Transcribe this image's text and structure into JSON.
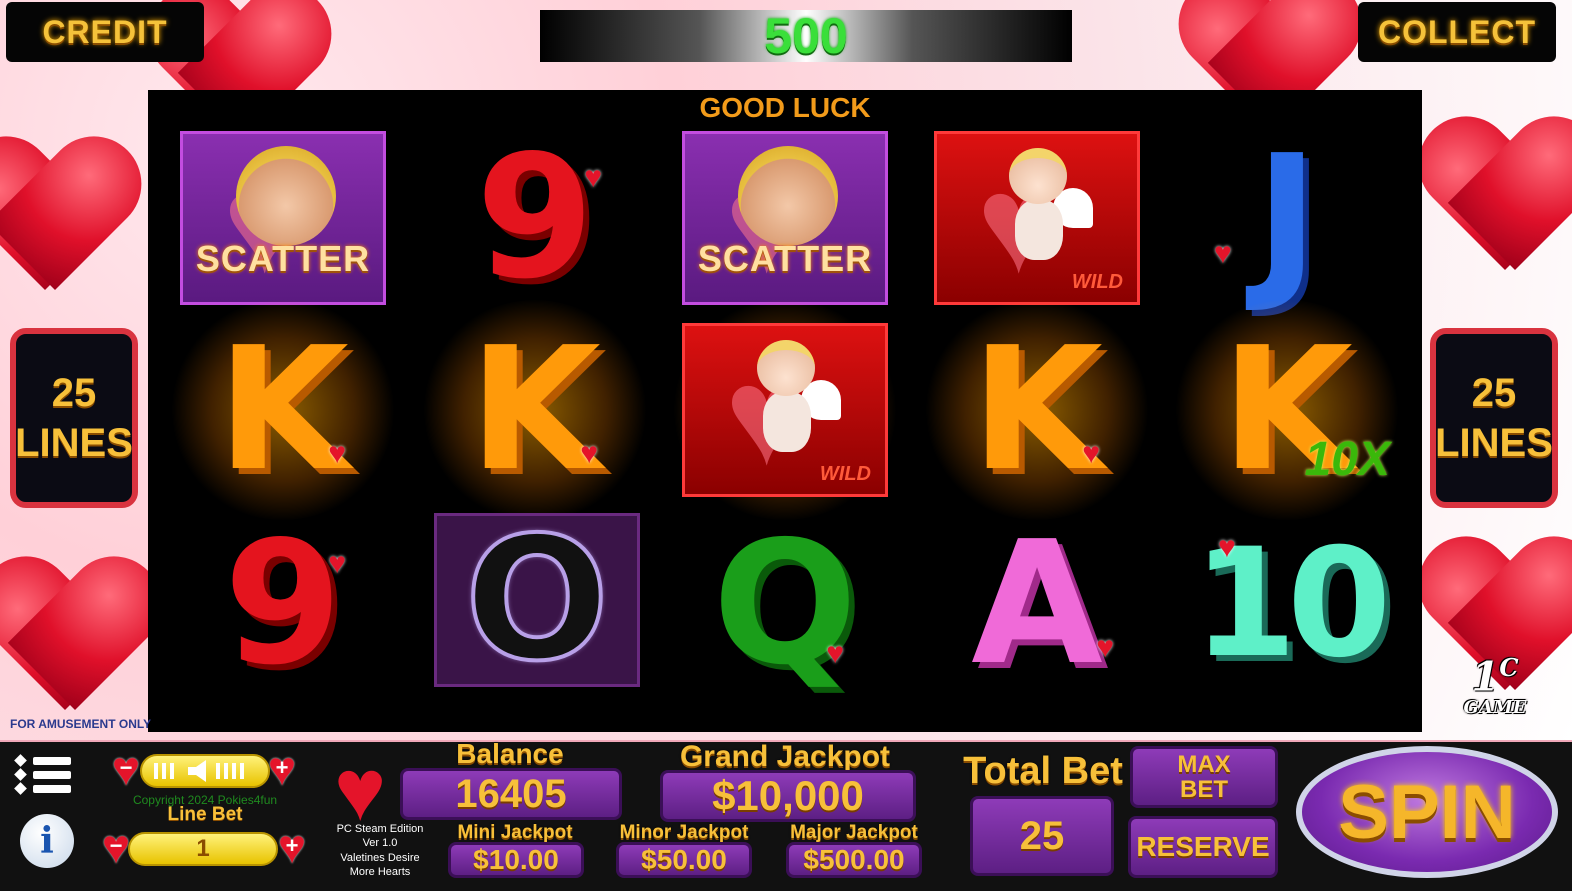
{
  "top_bar": {
    "credit_label": "CREDIT",
    "win_value": "500",
    "collect_label": "COLLECT"
  },
  "status": {
    "message": "GOOD LUCK"
  },
  "lines": {
    "left_count": "25",
    "left_label": "LINES",
    "right_count": "25",
    "right_label": "LINES"
  },
  "reels": [
    [
      {
        "symbol": "scatter",
        "label": "SCATTER"
      },
      {
        "symbol": "K",
        "glow": true
      },
      {
        "symbol": "9",
        "color": "#e4141e"
      }
    ],
    [
      {
        "symbol": "9",
        "color": "#e4141e"
      },
      {
        "symbol": "K",
        "glow": true
      },
      {
        "symbol": "O",
        "color": "#111111"
      }
    ],
    [
      {
        "symbol": "scatter",
        "label": "SCATTER"
      },
      {
        "symbol": "wild",
        "label": "WILD",
        "glow": true
      },
      {
        "symbol": "Q",
        "color": "#1a9e1a"
      }
    ],
    [
      {
        "symbol": "wild",
        "label": "WILD"
      },
      {
        "symbol": "K",
        "glow": true
      },
      {
        "symbol": "A",
        "color": "#f06ad8"
      }
    ],
    [
      {
        "symbol": "J",
        "color": "#2a6be8"
      },
      {
        "symbol": "K",
        "glow": true,
        "multiplier": "10X"
      },
      {
        "symbol": "10",
        "color": "#5ef0c8"
      }
    ]
  ],
  "footer": {
    "amusement": "FOR AMUSEMENT ONLY",
    "logo_main": "1",
    "logo_sup": "C",
    "logo_sub": "GAME"
  },
  "panel": {
    "copyright": "Copyright 2024 Pokies4fun",
    "line_bet_label": "Line Bet",
    "line_bet_value": "1",
    "edition_lines": [
      "PC Steam Edition",
      "Ver 1.0",
      "Valetines Desire",
      "More Hearts"
    ],
    "balance_label": "Balance",
    "balance_value": "16405",
    "grand_label": "Grand Jackpot",
    "grand_value": "$10,000",
    "mini_label": "Mini Jackpot",
    "mini_value": "$10.00",
    "minor_label": "Minor Jackpot",
    "minor_value": "$50.00",
    "major_label": "Major Jackpot",
    "major_value": "$500.00",
    "total_bet_label": "Total Bet",
    "total_bet_value": "25",
    "max_bet_line1": "MAX",
    "max_bet_line2": "BET",
    "reserve_label": "RESERVE",
    "spin_label": "SPIN",
    "minus": "−",
    "plus": "+",
    "info_glyph": "i",
    "heart_glyph": "♥"
  },
  "colors": {
    "accent_gold": "#f7c03a",
    "panel_purple": "#8e3bb8",
    "heart_red": "#e4142a",
    "win_green": "#3adf3a"
  }
}
